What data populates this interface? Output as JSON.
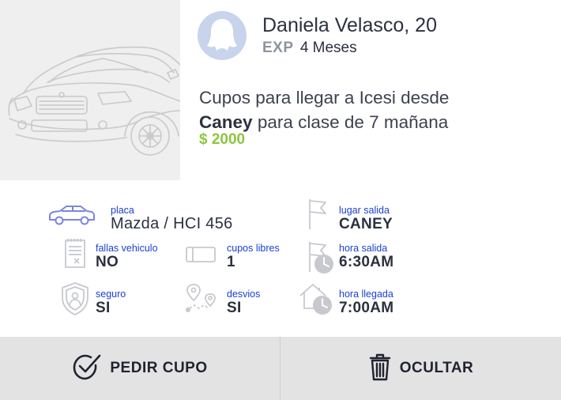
{
  "driver": {
    "name": "Daniela Velasco, 20",
    "exp_label": "EXP",
    "exp_value": "4 Meses"
  },
  "trip": {
    "desc_prefix": "Cupos para llegar a Icesi desde",
    "origin": "Caney",
    "desc_suffix": "para clase de 7 mañana",
    "price": "$ 2000"
  },
  "details": {
    "placa": {
      "label": "placa",
      "value": "Mazda / HCI 456"
    },
    "lugar_salida": {
      "label": "lugar salida",
      "value": "CANEY"
    },
    "fallas": {
      "label": "fallas vehiculo",
      "value": "NO"
    },
    "cupos": {
      "label": "cupos libres",
      "value": "1"
    },
    "hora_salida": {
      "label": "hora salida",
      "value": "6:30AM"
    },
    "seguro": {
      "label": "seguro",
      "value": "SI"
    },
    "desvios": {
      "label": "desvios",
      "value": "SI"
    },
    "hora_llegada": {
      "label": "hora llegada",
      "value": "7:00AM"
    }
  },
  "actions": {
    "pedir_label": "PEDIR CUPO",
    "ocultar_label": "OCULTAR"
  },
  "icons": {
    "car": "car-icon",
    "flag": "flag-icon",
    "checklist": "checklist-icon",
    "seat": "seat-icon",
    "flag_clock": "flag-clock-icon",
    "shield": "shield-user-icon",
    "route": "route-icon",
    "home_clock": "home-clock-icon",
    "check": "check-circle-icon",
    "trash": "trash-icon"
  },
  "colors": {
    "accent_price": "#8cc63f",
    "label_blue": "#1a3fd4",
    "icon_blue": "#7b86d9",
    "icon_gray": "#c7c9cf",
    "action_bar": "#e3e3e3"
  }
}
